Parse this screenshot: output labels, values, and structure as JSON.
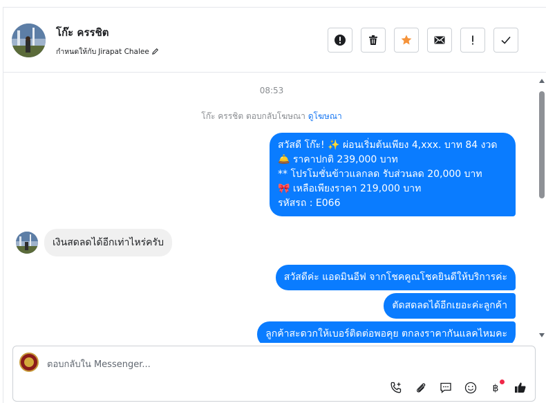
{
  "header": {
    "name": "โก๊ะ ครรชิต",
    "assign_prefix": "กำหนดให้กับ",
    "assignee": "Jirapat Chalee",
    "toolbar": [
      {
        "name": "spam-button",
        "icon": "alert-circle-icon"
      },
      {
        "name": "delete-button",
        "icon": "trash-icon"
      },
      {
        "name": "star-button",
        "icon": "star-icon"
      },
      {
        "name": "mark-unread-button",
        "icon": "envelope-icon"
      },
      {
        "name": "follow-up-button",
        "icon": "exclamation-icon"
      },
      {
        "name": "mark-done-button",
        "icon": "check-icon"
      }
    ]
  },
  "chat": {
    "timestamp": "08:53",
    "reply_note": "โก๊ะ ครรชิต ตอบกลับโฆษณา",
    "reply_note_link": "ดูโฆษณา",
    "outgoing_1": {
      "line1": "สวัสดี โก๊ะ! ✨  ผ่อนเริ่มต้นเพียง 4,xxx. บาท 84 งวด",
      "line2": "🛎️ ราคาปกติ 239,000 บาท",
      "line3": "** โปรโมชั่นข้าวแลกลด รับส่วนลด 20,000 บาท",
      "line4": "🎀  เหลือเพียงราคา 219,000 บาท",
      "line5": " รหัสรถ : E066"
    },
    "incoming_1": "เงินสดลดได้อีกเท่าไหร่ครับ",
    "outgoing_2": "สวัสดีค่ะ แอดมินอีฟ จากโชคคูณโชคยินดีให้บริการค่ะ",
    "outgoing_3": "ตัดสดลดได้อีกเยอะค่ะลูกค้า",
    "outgoing_4": "ลูกค้าสะดวกให้เบอร์ติดต่อพอคุย ตกลงราคากันแลคไหมคะ"
  },
  "composer": {
    "placeholder": "ตอบกลับใน Messenger...",
    "icons": [
      "phone-plus-icon",
      "paperclip-icon",
      "chat-bubble-icon",
      "emoji-icon",
      "baht-icon",
      "thumbs-up-icon"
    ]
  },
  "colors": {
    "accent": "#0a7cff",
    "link": "#1877f2",
    "star": "#f5933a",
    "notification": "#f02849"
  }
}
